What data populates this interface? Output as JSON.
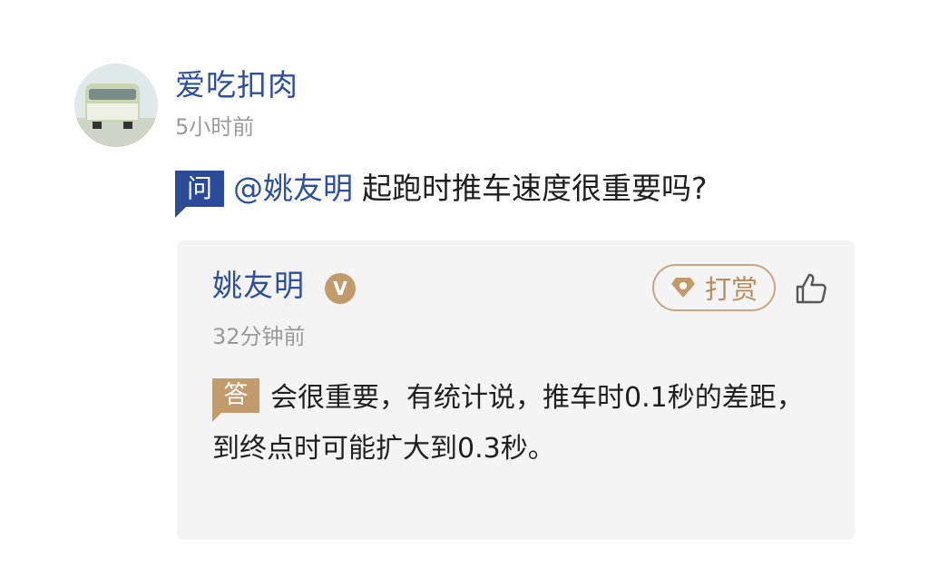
{
  "post": {
    "username": "爱吃扣肉",
    "time": "5小时前"
  },
  "question": {
    "badge": "问",
    "mention": "@姚友明",
    "text": "起跑时推车速度很重要吗?"
  },
  "answer": {
    "name": "姚友明",
    "verified_badge": "V",
    "tip_label": "打赏",
    "time": "32分钟前",
    "badge": "答",
    "text": "会很重要，有统计说，推车时0.1秒的差距，到终点时可能扩大到0.3秒。"
  },
  "icons": {
    "tip": "gem-icon",
    "like": "thumbs-up-icon",
    "avatar": "van-photo"
  },
  "colors": {
    "link_blue": "#2c4f9e",
    "question_badge": "#2b4a97",
    "answer_gold": "#c19b6c",
    "card_bg": "#f4f4f4",
    "muted": "#9a9a9a"
  }
}
